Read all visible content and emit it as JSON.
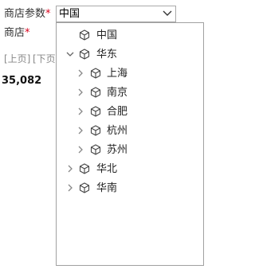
{
  "form": {
    "shop_param_label": "商店参数",
    "shop_param_required": "*",
    "shop_label": "商店",
    "shop_required": "*",
    "select_value": "中国"
  },
  "pager": {
    "prev_label": "[上页]",
    "next_label": "[下页"
  },
  "summary": {
    "value": "35,082"
  },
  "tree": {
    "items": [
      {
        "label": "中国",
        "expandable": false,
        "expanded": false
      },
      {
        "label": "华东",
        "expandable": true,
        "expanded": true
      },
      {
        "label": "上海",
        "expandable": true,
        "expanded": false
      },
      {
        "label": "南京",
        "expandable": true,
        "expanded": false
      },
      {
        "label": "合肥",
        "expandable": true,
        "expanded": false
      },
      {
        "label": "杭州",
        "expandable": true,
        "expanded": false
      },
      {
        "label": "苏州",
        "expandable": true,
        "expanded": false
      },
      {
        "label": "华北",
        "expandable": true,
        "expanded": false
      },
      {
        "label": "华南",
        "expandable": true,
        "expanded": false
      }
    ]
  },
  "icons": {
    "node": "cube-icon",
    "expanded_toggle": "chevron-down-icon",
    "collapsed_toggle": "chevron-right-icon",
    "select_arrow": "chevron-down-icon"
  },
  "colors": {
    "required": "#d9001b",
    "pager_text": "#888888",
    "border": "#a0a0a0"
  }
}
